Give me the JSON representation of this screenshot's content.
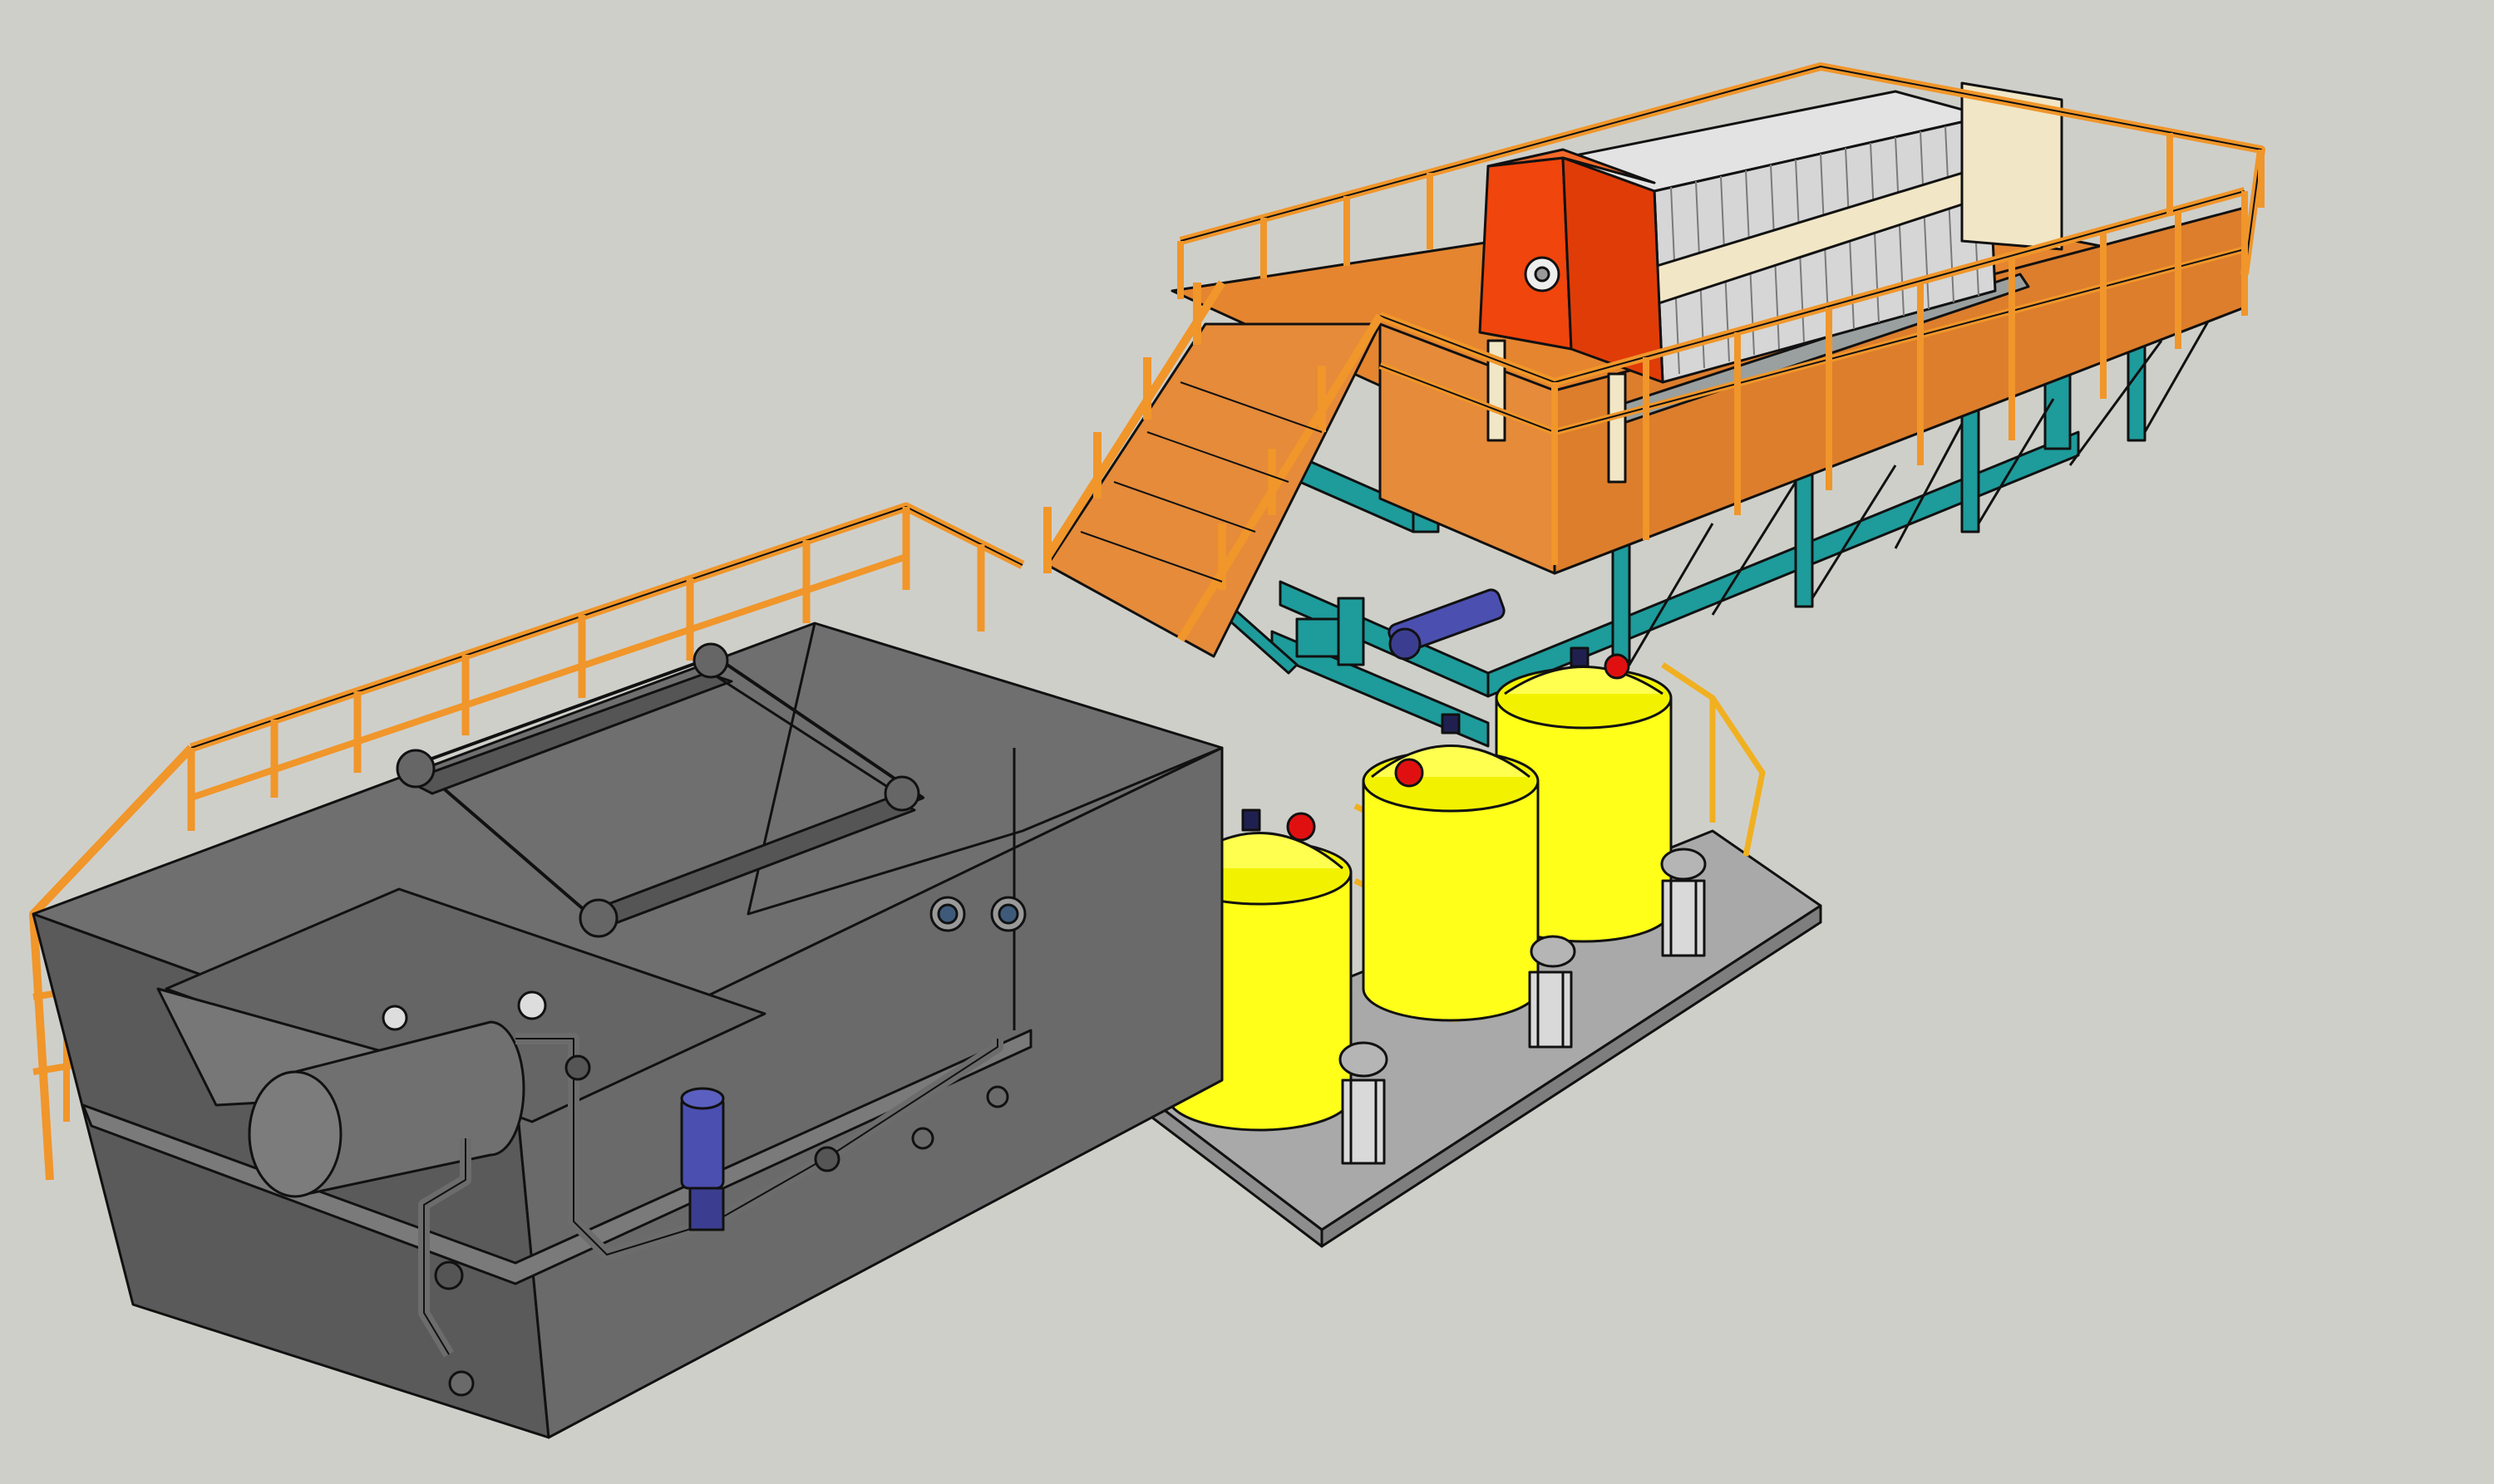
{
  "scene": {
    "background": "#cfcfca",
    "colors": {
      "railing": "#f0962a",
      "railing_dark": "#c9731a",
      "deck": "#e5852f",
      "steel_frame": "#1e9b9b",
      "tank_gray": "#6f6f6f",
      "tank_gray_dark": "#5a5a5a",
      "tank_gray_light": "#8a8a8a",
      "chem_tank": "#ffff1a",
      "chem_tank_shade": "#d9d900",
      "filter_head": "#f0450c",
      "filter_plates": "#dcdcdc",
      "filter_frame": "#f1e6c6",
      "skid": "#a9a9a9",
      "pump_blue": "#4b4fb0",
      "cap_red": "#e11010",
      "cap_navy": "#202050"
    },
    "components": {
      "daf_tank": "daf-flotation-tank",
      "filter_press": "plate-filter-press",
      "platform": "elevated-steel-platform",
      "chemical_tanks": [
        "chemical-dosing-tank-1",
        "chemical-dosing-tank-2",
        "chemical-dosing-tank-3"
      ],
      "dosing_pumps": [
        "dosing-pump-1",
        "dosing-pump-2",
        "dosing-pump-3"
      ],
      "pumps": [
        "screw-pump",
        "recirculation-pump"
      ]
    }
  }
}
